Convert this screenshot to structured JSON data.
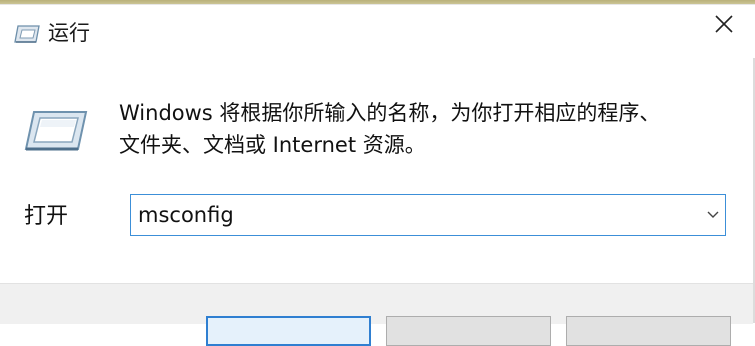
{
  "window": {
    "title": "运行",
    "icon": "run-icon",
    "close_icon": "close-icon"
  },
  "description": {
    "line1": "Windows 将根据你所输入的名称，为你打开相应的程序、",
    "line2": "文件夹、文档或 Internet 资源。"
  },
  "open": {
    "label": "打开",
    "value": "msconfig"
  },
  "colors": {
    "focus_border": "#3c8fd8",
    "footer_bg": "#f0f0f0"
  }
}
